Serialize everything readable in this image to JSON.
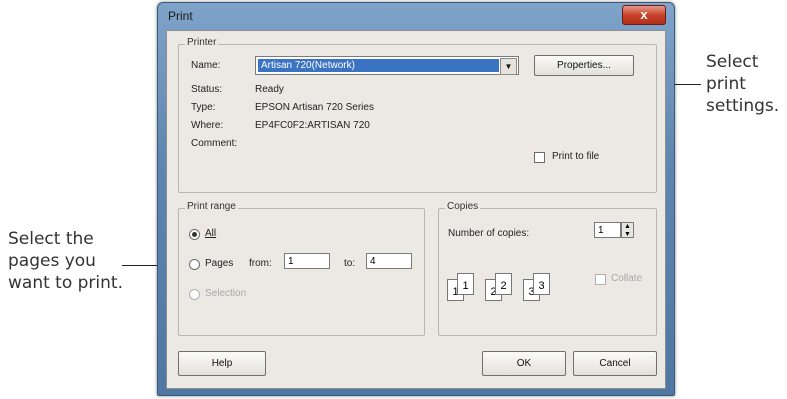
{
  "callouts": {
    "right": [
      "Select",
      "print",
      "settings."
    ],
    "left": [
      "Select the",
      "pages you",
      "want to print."
    ]
  },
  "window": {
    "title": "Print",
    "close_glyph": "x"
  },
  "printer": {
    "group_label": "Printer",
    "name_label": "Name:",
    "name_value": "Artisan 720(Network)",
    "properties_button": "Properties...",
    "status_label": "Status:",
    "status_value": "Ready",
    "type_label": "Type:",
    "type_value": "EPSON Artisan 720 Series",
    "where_label": "Where:",
    "where_value": "EP4FC0F2:ARTISAN 720",
    "comment_label": "Comment:",
    "print_to_file_label": "Print to file"
  },
  "print_range": {
    "group_label": "Print range",
    "all_label": "All",
    "pages_label": "Pages",
    "from_label": "from:",
    "from_value": "1",
    "to_label": "to:",
    "to_value": "4",
    "selection_label": "Selection"
  },
  "copies": {
    "group_label": "Copies",
    "number_label": "Number of copies:",
    "number_value": "1",
    "collate_label": "Collate",
    "collate_pages": [
      "1",
      "1",
      "2",
      "2",
      "3",
      "3"
    ]
  },
  "footer": {
    "help_button": "Help",
    "ok_button": "OK",
    "cancel_button": "Cancel"
  }
}
